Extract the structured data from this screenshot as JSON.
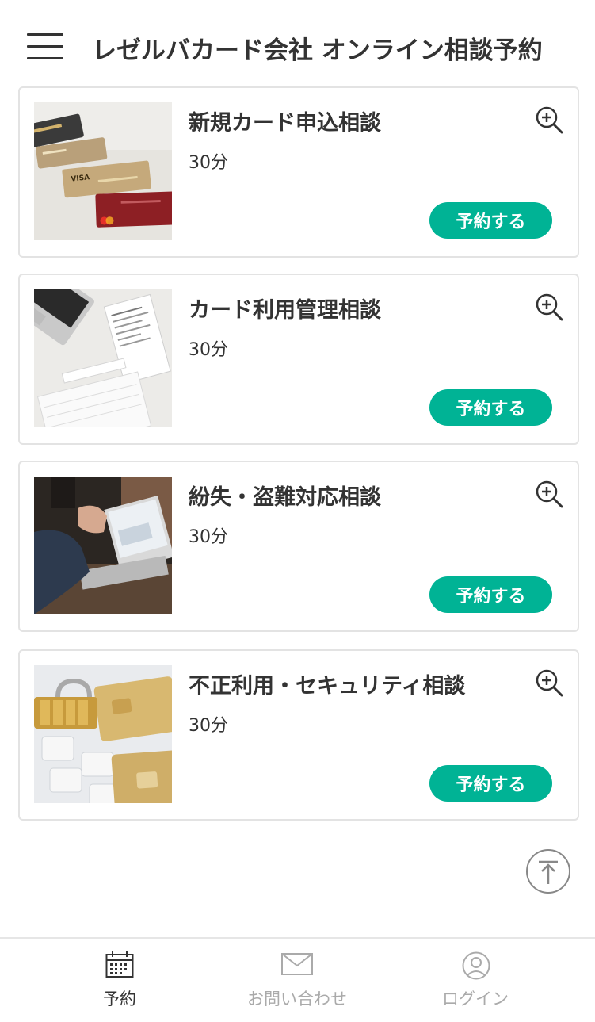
{
  "header": {
    "title": "レゼルバカード会社 オンライン相談予約",
    "menu_icon": "hamburger-menu-icon"
  },
  "services": [
    {
      "title": "新規カード申込相談",
      "duration": "30分",
      "button_label": "予約する",
      "image": "credit-cards-photo"
    },
    {
      "title": "カード利用管理相談",
      "duration": "30分",
      "button_label": "予約する",
      "image": "laptop-receipts-photo"
    },
    {
      "title": "紛失・盗難対応相談",
      "duration": "30分",
      "button_label": "予約する",
      "image": "business-laptop-photo"
    },
    {
      "title": "不正利用・セキュリティ相談",
      "duration": "30分",
      "button_label": "予約する",
      "image": "padlock-card-photo"
    }
  ],
  "scroll_top_icon": "arrow-up-circle-icon",
  "bottom_nav": {
    "items": [
      {
        "label": "予約",
        "icon": "calendar-icon",
        "active": true
      },
      {
        "label": "お問い合わせ",
        "icon": "envelope-icon",
        "active": false
      },
      {
        "label": "ログイン",
        "icon": "user-circle-icon",
        "active": false
      }
    ]
  },
  "colors": {
    "accent": "#00b395",
    "text": "#333333",
    "inactive": "#aaaaaa",
    "border": "#e3e3e3"
  }
}
